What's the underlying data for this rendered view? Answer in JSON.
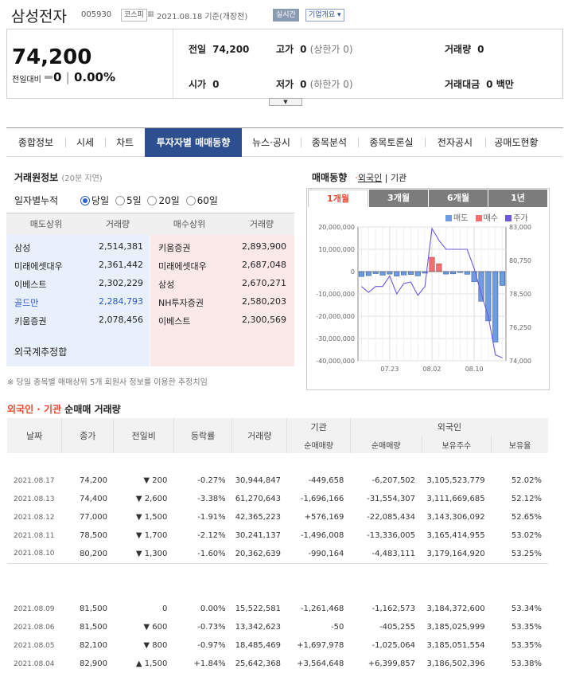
{
  "header": {
    "name": "삼성전자",
    "code": "005930",
    "market": "코스피",
    "date": "2021.08.18 기준(개장전)",
    "realtime": "실시간",
    "overview": "기업개요 ▾"
  },
  "quote": {
    "price": "74,200",
    "change_label": "전일대비",
    "change": "0",
    "rate": "0.00%",
    "items": [
      {
        "label": "전일",
        "value": "74,200",
        "sub": ""
      },
      {
        "label": "고가",
        "value": "0",
        "sub": "(상한가 0)"
      },
      {
        "label": "거래량",
        "value": "0",
        "sub": ""
      },
      {
        "label": "시가",
        "value": "0",
        "sub": ""
      },
      {
        "label": "저가",
        "value": "0",
        "sub": "(하한가 0)"
      },
      {
        "label": "거래대금",
        "value": "0 백만",
        "sub": ""
      }
    ]
  },
  "tabs": [
    "종합정보",
    "시세",
    "차트",
    "투자자별 매매동향",
    "뉴스·공시",
    "종목분석",
    "종목토론실",
    "전자공시",
    "공매도현황"
  ],
  "broker": {
    "title": "거래원정보",
    "delay": "(20분 지연)",
    "period_label": "일자별누적",
    "periods": [
      "당일",
      "5일",
      "20일",
      "60일"
    ],
    "headers": [
      "매도상위",
      "거래량",
      "매수상위",
      "거래량"
    ],
    "sell": [
      [
        "삼성",
        "2,514,381"
      ],
      [
        "미래에셋대우",
        "2,361,442"
      ],
      [
        "이베스트",
        "2,302,229"
      ],
      [
        "골드만",
        "2,284,793"
      ],
      [
        "키움증권",
        "2,078,456"
      ]
    ],
    "buy": [
      [
        "키움증권",
        "2,893,900"
      ],
      [
        "미래에셋대우",
        "2,687,048"
      ],
      [
        "삼성",
        "2,670,271"
      ],
      [
        "NH투자증권",
        "2,580,203"
      ],
      [
        "이베스트",
        "2,300,569"
      ]
    ],
    "foreign": "외국계추정합",
    "note": "※ 당일 종목별 매매상위 5개 회원사 정보를 이용한 추정치임"
  },
  "trend": {
    "title": "매매동향",
    "opt1": "외국인",
    "opt2": "기관",
    "ranges": [
      "1개월",
      "3개월",
      "6개월",
      "1년"
    ],
    "legend": [
      "매도",
      "매수",
      "주가"
    ]
  },
  "chart_data": {
    "type": "bar",
    "title": "",
    "x": [
      "07.19",
      "07.20",
      "07.21",
      "07.22",
      "07.23",
      "07.26",
      "07.27",
      "07.28",
      "07.29",
      "07.30",
      "08.02",
      "08.03",
      "08.04",
      "08.05",
      "08.06",
      "08.09",
      "08.10",
      "08.11",
      "08.12",
      "08.13",
      "08.17"
    ],
    "series": [
      {
        "name": "",
        "values": [
          -2200000,
          -1800000,
          -900000,
          -1600000,
          -1100000,
          -2000000,
          -1500000,
          -1300000,
          -1900000,
          -700000,
          6400000,
          3500000,
          -1100000,
          -1000000,
          -400000,
          -1200000,
          -4500000,
          -13300000,
          -22100000,
          -31600000,
          -6200000
        ]
      }
    ],
    "price": {
      "values": [
        79000,
        78600,
        79000,
        79000,
        79700,
        78500,
        79200,
        79300,
        78400,
        79000,
        82900,
        82100,
        81500,
        81500,
        81500,
        81500,
        80200,
        78500,
        77000,
        74400,
        74200
      ]
    },
    "ylim": [
      -40000000,
      20000000
    ],
    "y2lim": [
      74000,
      83000
    ],
    "yticks": [
      "20,000,000",
      "10,000,000",
      "0",
      "-10,000,000",
      "-20,000,000",
      "-30,000,000",
      "-40,000,000"
    ],
    "y2ticks": [
      "83,000",
      "80,750",
      "78,500",
      "76,250",
      "74,000"
    ],
    "xticks": [
      "07.23",
      "08.02",
      "08.10"
    ]
  },
  "colors": {
    "sell": "#6f9be0",
    "buy": "#ee7070",
    "price": "#6b59e0",
    "up": "#e5262b",
    "down": "#2a59c7"
  },
  "investor": {
    "title_red": "외국인 · 기관",
    "title_rest": " 순매매 거래량",
    "headers": [
      "날짜",
      "종가",
      "전일비",
      "등락률",
      "거래량",
      "기관",
      "외국인",
      "순매매량",
      "순매매량",
      "보유주수",
      "보유율"
    ],
    "rows": [
      {
        "date": "2021.08.17",
        "close": "74,200",
        "arrow": "▼",
        "diff": "200",
        "rate": "-0.27%",
        "vol": "30,944,847",
        "inst": "-449,658",
        "frgn": "-6,207,502",
        "hold": "3,105,523,779",
        "ratio": "52.02%"
      },
      {
        "date": "2021.08.13",
        "close": "74,400",
        "arrow": "▼",
        "diff": "2,600",
        "rate": "-3.38%",
        "vol": "61,270,643",
        "inst": "-1,696,166",
        "frgn": "-31,554,307",
        "hold": "3,111,669,685",
        "ratio": "52.12%"
      },
      {
        "date": "2021.08.12",
        "close": "77,000",
        "arrow": "▼",
        "diff": "1,500",
        "rate": "-1.91%",
        "vol": "42,365,223",
        "inst": "+576,169",
        "frgn": "-22,085,434",
        "hold": "3,143,306,092",
        "ratio": "52.65%"
      },
      {
        "date": "2021.08.11",
        "close": "78,500",
        "arrow": "▼",
        "diff": "1,700",
        "rate": "-2.12%",
        "vol": "30,241,137",
        "inst": "-1,496,008",
        "frgn": "-13,336,005",
        "hold": "3,165,414,955",
        "ratio": "53.02%"
      },
      {
        "date": "2021.08.10",
        "close": "80,200",
        "arrow": "▼",
        "diff": "1,300",
        "rate": "-1.60%",
        "vol": "20,362,639",
        "inst": "-990,164",
        "frgn": "-4,483,111",
        "hold": "3,179,164,920",
        "ratio": "53.25%"
      },
      {
        "date": "2021.08.09",
        "close": "81,500",
        "arrow": "",
        "diff": "0",
        "rate": "0.00%",
        "vol": "15,522,581",
        "inst": "-1,261,468",
        "frgn": "-1,162,573",
        "hold": "3,184,372,600",
        "ratio": "53.34%"
      },
      {
        "date": "2021.08.06",
        "close": "81,500",
        "arrow": "▼",
        "diff": "600",
        "rate": "-0.73%",
        "vol": "13,342,623",
        "inst": "-50",
        "frgn": "-405,255",
        "hold": "3,185,025,999",
        "ratio": "53.35%"
      },
      {
        "date": "2021.08.05",
        "close": "82,100",
        "arrow": "▼",
        "diff": "800",
        "rate": "-0.97%",
        "vol": "18,485,469",
        "inst": "+1,697,978",
        "frgn": "-1,025,064",
        "hold": "3,185,051,554",
        "ratio": "53.35%"
      },
      {
        "date": "2021.08.04",
        "close": "82,900",
        "arrow": "▲",
        "diff": "1,500",
        "rate": "+1.84%",
        "vol": "25,642,368",
        "inst": "+3,564,648",
        "frgn": "+6,399,857",
        "hold": "3,186,502,396",
        "ratio": "53.38%"
      }
    ]
  }
}
